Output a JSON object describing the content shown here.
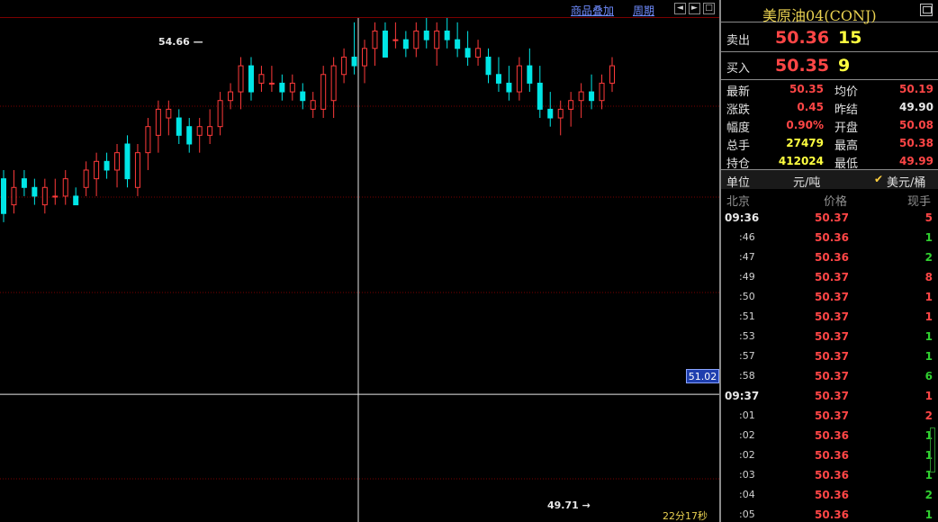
{
  "toolbar": {
    "overlay_label": "商品叠加",
    "period_label": "周期"
  },
  "colors": {
    "up": "#ff3a3a",
    "down": "#00e6e6",
    "grid": "#7a0000",
    "crosshair": "#e8e8e8",
    "price_red": "#ff4646",
    "price_green": "#30d030",
    "vol_yellow": "#ffff40"
  },
  "chart": {
    "crosshair_price": "51.02",
    "high_label": "54.66",
    "low_label": "49.71",
    "countdown": "22分17秒",
    "chart_data": {
      "type": "candlestick",
      "y_range": [
        49.55,
        55.35
      ],
      "crosshair_value": 51.02,
      "high_marker": 54.66,
      "low_marker": 49.71,
      "candles": [
        [
          53.5,
          53.6,
          53.0,
          53.1
        ],
        [
          53.2,
          53.6,
          53.1,
          53.4
        ],
        [
          53.5,
          53.6,
          53.3,
          53.4
        ],
        [
          53.4,
          53.5,
          53.2,
          53.3
        ],
        [
          53.2,
          53.5,
          53.1,
          53.4
        ],
        [
          53.3,
          53.5,
          53.2,
          53.3
        ],
        [
          53.3,
          53.6,
          53.2,
          53.5
        ],
        [
          53.3,
          53.4,
          53.2,
          53.2
        ],
        [
          53.4,
          53.7,
          53.3,
          53.6
        ],
        [
          53.5,
          53.8,
          53.3,
          53.7
        ],
        [
          53.7,
          53.8,
          53.5,
          53.6
        ],
        [
          53.6,
          53.9,
          53.4,
          53.8
        ],
        [
          53.9,
          54.0,
          53.4,
          53.5
        ],
        [
          53.4,
          53.9,
          53.3,
          53.8
        ],
        [
          53.8,
          54.2,
          53.6,
          54.1
        ],
        [
          54.0,
          54.4,
          53.8,
          54.3
        ],
        [
          54.2,
          54.4,
          54.0,
          54.3
        ],
        [
          54.2,
          54.3,
          53.9,
          54.0
        ],
        [
          54.1,
          54.2,
          53.8,
          53.9
        ],
        [
          54.0,
          54.2,
          53.8,
          54.1
        ],
        [
          54.0,
          54.3,
          53.9,
          54.1
        ],
        [
          54.1,
          54.5,
          54.0,
          54.4
        ],
        [
          54.4,
          54.6,
          54.3,
          54.5
        ],
        [
          54.5,
          54.9,
          54.3,
          54.8
        ],
        [
          54.8,
          54.9,
          54.4,
          54.5
        ],
        [
          54.6,
          54.8,
          54.5,
          54.7
        ],
        [
          54.6,
          54.8,
          54.5,
          54.6
        ],
        [
          54.6,
          54.7,
          54.4,
          54.5
        ],
        [
          54.5,
          54.7,
          54.4,
          54.6
        ],
        [
          54.5,
          54.6,
          54.3,
          54.4
        ],
        [
          54.3,
          54.5,
          54.2,
          54.4
        ],
        [
          54.3,
          54.8,
          54.2,
          54.7
        ],
        [
          54.4,
          54.9,
          54.2,
          54.8
        ],
        [
          54.7,
          55.0,
          54.6,
          54.9
        ],
        [
          54.9,
          55.3,
          54.7,
          54.8
        ],
        [
          54.8,
          55.1,
          54.6,
          55.0
        ],
        [
          55.0,
          55.3,
          54.8,
          55.2
        ],
        [
          55.2,
          54.9,
          55.3,
          54.9
        ],
        [
          55.1,
          55.3,
          55.0,
          55.1
        ],
        [
          55.1,
          55.2,
          54.9,
          55.0
        ],
        [
          55.0,
          55.3,
          54.9,
          55.2
        ],
        [
          55.2,
          55.4,
          55.0,
          55.1
        ],
        [
          55.0,
          55.3,
          54.8,
          55.2
        ],
        [
          55.2,
          55.4,
          55.0,
          55.1
        ],
        [
          55.1,
          55.3,
          54.9,
          55.0
        ],
        [
          55.0,
          55.2,
          54.8,
          54.9
        ],
        [
          54.9,
          55.1,
          54.8,
          55.0
        ],
        [
          54.9,
          55.0,
          54.6,
          54.7
        ],
        [
          54.7,
          54.9,
          54.5,
          54.6
        ],
        [
          54.6,
          54.8,
          54.4,
          54.5
        ],
        [
          54.5,
          54.9,
          54.4,
          54.8
        ],
        [
          54.8,
          55.0,
          54.5,
          54.6
        ],
        [
          54.6,
          54.8,
          54.2,
          54.3
        ],
        [
          54.3,
          54.5,
          54.1,
          54.2
        ],
        [
          54.2,
          54.4,
          54.0,
          54.3
        ],
        [
          54.3,
          54.5,
          54.1,
          54.4
        ],
        [
          54.4,
          54.6,
          54.2,
          54.5
        ],
        [
          54.5,
          54.7,
          54.3,
          54.4
        ],
        [
          54.4,
          54.7,
          54.3,
          54.6
        ],
        [
          54.6,
          54.9,
          54.5,
          54.8
        ]
      ]
    }
  },
  "panel": {
    "title": "美原油04(CONJ)",
    "sell": {
      "label": "卖出",
      "price": "50.36",
      "volume": "15"
    },
    "buy": {
      "label": "买入",
      "price": "50.35",
      "volume": "9"
    },
    "stats": [
      {
        "l1": "最新",
        "v1": "50.35",
        "c1": "red",
        "l2": "均价",
        "v2": "50.19",
        "c2": "red"
      },
      {
        "l1": "涨跌",
        "v1": "0.45",
        "c1": "red",
        "l2": "昨结",
        "v2": "49.90",
        "c2": "white"
      },
      {
        "l1": "幅度",
        "v1": "0.90%",
        "c1": "red",
        "l2": "开盘",
        "v2": "50.08",
        "c2": "red"
      },
      {
        "l1": "总手",
        "v1": "27479",
        "c1": "yellow",
        "l2": "最高",
        "v2": "50.38",
        "c2": "red"
      },
      {
        "l1": "持仓",
        "v1": "412024",
        "c1": "yellow",
        "l2": "最低",
        "v2": "49.99",
        "c2": "red"
      }
    ],
    "unit": {
      "label": "单位",
      "opt1": "元/吨",
      "check": "✔",
      "opt2": "美元/桶"
    },
    "tick_header": {
      "time": "北京",
      "price": "价格",
      "volume": "现手"
    },
    "ticks": [
      {
        "time": "09:36",
        "full": true,
        "price": "50.37",
        "vol": "5",
        "dir": "red"
      },
      {
        "time": ":46",
        "full": false,
        "price": "50.36",
        "vol": "1",
        "dir": "green"
      },
      {
        "time": ":47",
        "full": false,
        "price": "50.36",
        "vol": "2",
        "dir": "green"
      },
      {
        "time": ":49",
        "full": false,
        "price": "50.37",
        "vol": "8",
        "dir": "red"
      },
      {
        "time": ":50",
        "full": false,
        "price": "50.37",
        "vol": "1",
        "dir": "red"
      },
      {
        "time": ":51",
        "full": false,
        "price": "50.37",
        "vol": "1",
        "dir": "red"
      },
      {
        "time": ":53",
        "full": false,
        "price": "50.37",
        "vol": "1",
        "dir": "green"
      },
      {
        "time": ":57",
        "full": false,
        "price": "50.37",
        "vol": "1",
        "dir": "green"
      },
      {
        "time": ":58",
        "full": false,
        "price": "50.37",
        "vol": "6",
        "dir": "green"
      },
      {
        "time": "09:37",
        "full": true,
        "price": "50.37",
        "vol": "1",
        "dir": "red"
      },
      {
        "time": ":01",
        "full": false,
        "price": "50.37",
        "vol": "2",
        "dir": "red"
      },
      {
        "time": ":02",
        "full": false,
        "price": "50.36",
        "vol": "1",
        "dir": "green"
      },
      {
        "time": ":02",
        "full": false,
        "price": "50.36",
        "vol": "1",
        "dir": "green"
      },
      {
        "time": ":03",
        "full": false,
        "price": "50.36",
        "vol": "1",
        "dir": "green"
      },
      {
        "time": ":04",
        "full": false,
        "price": "50.36",
        "vol": "2",
        "dir": "green"
      },
      {
        "time": ":05",
        "full": false,
        "price": "50.36",
        "vol": "1",
        "dir": "green"
      }
    ]
  }
}
